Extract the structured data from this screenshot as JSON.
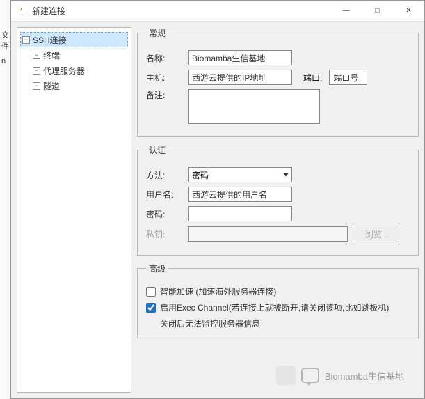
{
  "edge": {
    "label1": "文件",
    "label2": "n"
  },
  "titlebar": {
    "title": "新建连接",
    "minimize": "—",
    "maximize": "□",
    "close": "✕"
  },
  "tree": {
    "root": "SSH连接",
    "children": [
      {
        "label": "终端"
      },
      {
        "label": "代理服务器"
      },
      {
        "label": "隧道"
      }
    ]
  },
  "general": {
    "legend": "常规",
    "name_label": "名称:",
    "name_value": "Biomamba生信基地",
    "host_label": "主机:",
    "host_value": "西游云提供的IP地址",
    "port_label": "端口:",
    "port_value": "端口号",
    "remark_label": "备注:",
    "remark_value": ""
  },
  "auth": {
    "legend": "认证",
    "method_label": "方法:",
    "method_value": "密码",
    "user_label": "用户名:",
    "user_value": "西游云提供的用户名",
    "pwd_label": "密码:",
    "pwd_value": "",
    "key_label": "私钥:",
    "key_value": "",
    "browse_btn": "浏览..."
  },
  "advanced": {
    "legend": "高级",
    "accel_label": "智能加速 (加速海外服务器连接)",
    "accel_checked": false,
    "exec_label": "启用Exec Channel(若连接上就被断开,请关闭该项,比如跳板机)",
    "exec_checked": true,
    "exec_hint": "关闭后无法监控服务器信息"
  },
  "watermark": "Biomamba生信基地"
}
